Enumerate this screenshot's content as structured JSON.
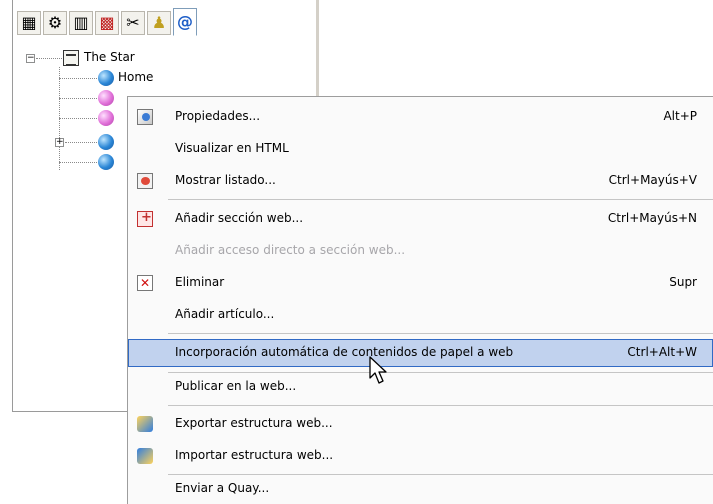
{
  "toolbar": {
    "buttons": [
      {
        "name": "newspaper-icon",
        "glyph": "▦",
        "active": false
      },
      {
        "name": "gear-icon",
        "glyph": "⚙",
        "active": false
      },
      {
        "name": "columns-icon",
        "glyph": "▥",
        "active": false
      },
      {
        "name": "grid-icon",
        "glyph": "▩",
        "active": false
      },
      {
        "name": "tools-icon",
        "glyph": "✂",
        "active": false
      },
      {
        "name": "people-icon",
        "glyph": "♟",
        "active": false
      },
      {
        "name": "web-icon",
        "glyph": "@",
        "active": true
      }
    ]
  },
  "tree": {
    "root": {
      "label": "The Star"
    },
    "nodes": [
      {
        "label": "Home",
        "type": "blue"
      },
      {
        "label": "",
        "type": "pink"
      },
      {
        "label": "",
        "type": "pink"
      },
      {
        "label": "",
        "type": "blue"
      },
      {
        "label": "",
        "type": "blue"
      }
    ]
  },
  "menu": {
    "items": [
      {
        "label": "Propiedades...",
        "shortcut": "Alt+P",
        "icon": "properties-icon"
      },
      {
        "label": "Visualizar en HTML",
        "shortcut": ""
      },
      {
        "label": "Mostrar listado...",
        "shortcut": "Ctrl+Mayús+V",
        "icon": "list-icon"
      },
      {
        "label": "Añadir sección web...",
        "shortcut": "Ctrl+Mayús+N",
        "icon": "add-section-icon"
      },
      {
        "label": "Añadir acceso directo a sección web...",
        "shortcut": "",
        "disabled": true
      },
      {
        "label": "Eliminar",
        "shortcut": "Supr",
        "icon": "delete-icon"
      },
      {
        "label": "Añadir artículo...",
        "shortcut": ""
      },
      {
        "label": "Incorporación automática de contenidos de papel a web",
        "shortcut": "Ctrl+Alt+W",
        "highlighted": true
      },
      {
        "label": "Publicar en la web...",
        "shortcut": ""
      },
      {
        "label": "Exportar estructura web...",
        "shortcut": "",
        "icon": "export-icon"
      },
      {
        "label": "Importar estructura web...",
        "shortcut": "",
        "icon": "import-icon"
      },
      {
        "label": "Enviar a Quay...",
        "shortcut": ""
      }
    ]
  },
  "colors": {
    "highlight_bg": "#c1d2ee",
    "highlight_border": "#316ac5",
    "disabled_text": "#a7a6aa"
  }
}
